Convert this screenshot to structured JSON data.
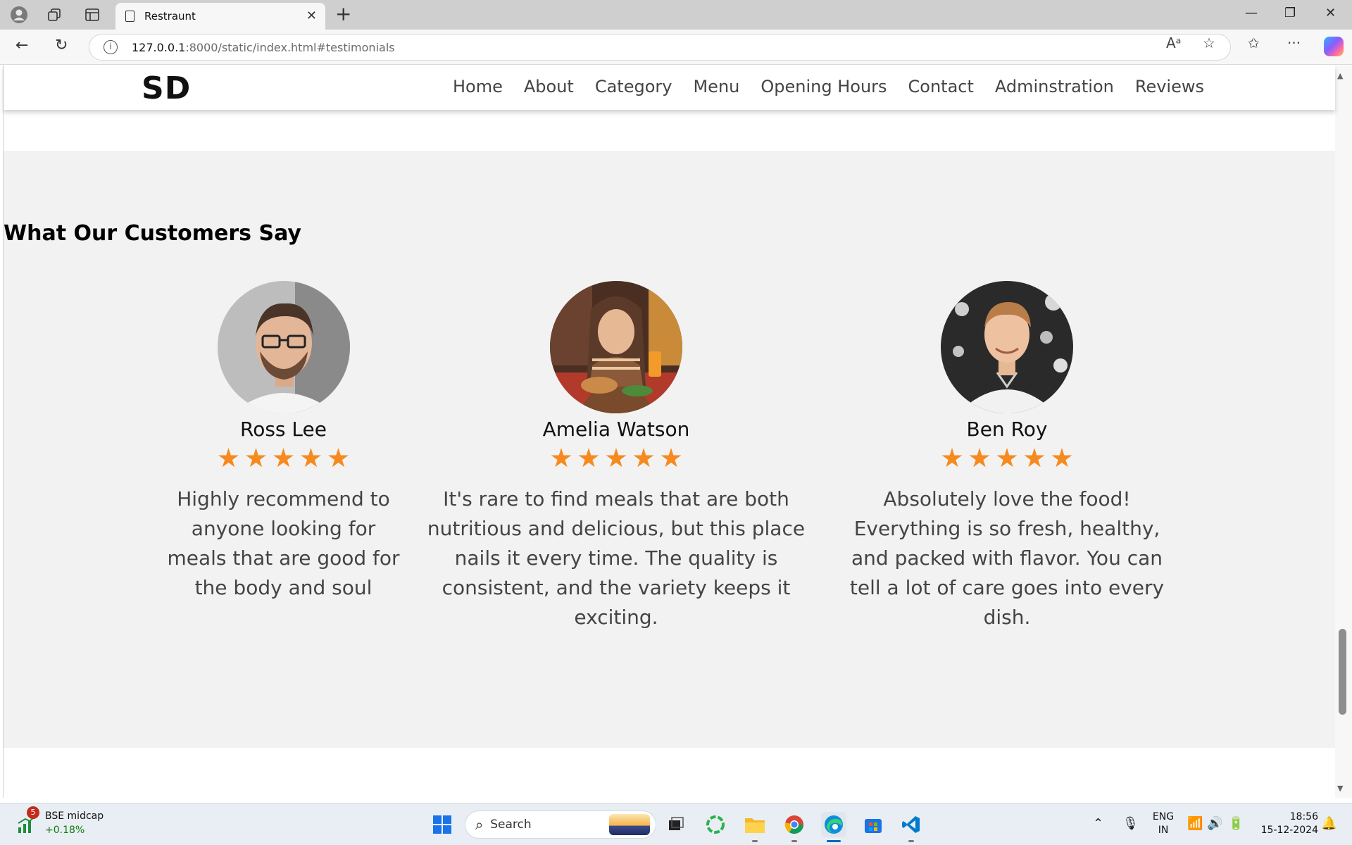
{
  "browser": {
    "tab_title": "Restraunt",
    "url_host": "127.0.0.1",
    "url_rest": ":8000/static/index.html#testimonials"
  },
  "site": {
    "logo": "SD",
    "nav": [
      "Home",
      "About",
      "Category",
      "Menu",
      "Opening Hours",
      "Contact",
      "Adminstration",
      "Reviews"
    ]
  },
  "testimonials": {
    "heading": "What Our Customers Say",
    "star_color": "#f68a1f",
    "reviews": [
      {
        "name": "Ross Lee",
        "rating": 5,
        "quote": "Highly recommend to anyone looking for meals that are good for the body and soul"
      },
      {
        "name": "Amelia Watson",
        "rating": 5,
        "quote": "It's rare to find meals that are both nutritious and delicious, but this place nails it every time. The quality is consistent, and the variety keeps it exciting."
      },
      {
        "name": "Ben Roy",
        "rating": 5,
        "quote": "Absolutely love the food! Everything is so fresh, healthy, and packed with flavor. You can tell a lot of care goes into every dish."
      }
    ]
  },
  "taskbar": {
    "widget_badge": "5",
    "widget_title": "BSE midcap",
    "widget_value": "+0.18%",
    "search_label": "Search",
    "lang_top": "ENG",
    "lang_bottom": "IN",
    "time": "18:56",
    "date": "15-12-2024"
  }
}
